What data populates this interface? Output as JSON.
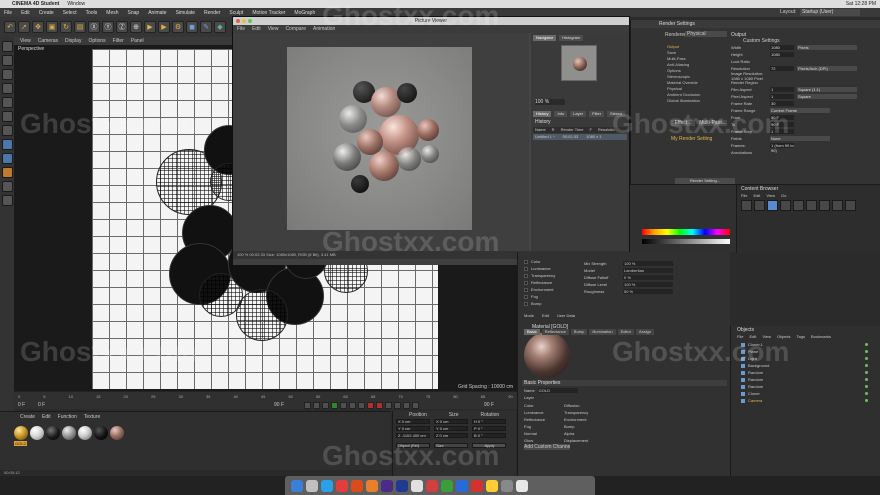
{
  "mac_menu": {
    "app": "CINEMA 4D Student",
    "window": "Window",
    "time": "Sat 12:28 PM"
  },
  "c4d_menu": [
    "File",
    "Edit",
    "Create",
    "Select",
    "Tools",
    "Mesh",
    "Snap",
    "Animate",
    "Simulate",
    "Render",
    "Sculpt",
    "Motion Tracker",
    "MoGraph"
  ],
  "layout_label": "Layout:",
  "layout_value": "Startup (User)",
  "viewport": {
    "menu": [
      "View",
      "Cameras",
      "Display",
      "Options",
      "Filter",
      "Panel"
    ],
    "name": "Perspective",
    "grid_spacing": "Grid Spacing : 10000 cm"
  },
  "timeline": {
    "ticks": [
      "0",
      "5",
      "10",
      "15",
      "20",
      "25",
      "30",
      "35",
      "40",
      "45",
      "50",
      "55",
      "60",
      "65",
      "70",
      "75",
      "80",
      "85",
      "90"
    ],
    "start": "0 F",
    "current": "0 F",
    "end": "90 F",
    "end2": "90 F"
  },
  "material_manager": {
    "menu": [
      "Create",
      "Edit",
      "Function",
      "Texture"
    ],
    "materials": [
      "GOLD",
      "",
      "",
      "",
      "",
      "",
      ""
    ]
  },
  "coordinates": {
    "headers": [
      "Position",
      "Size",
      "Rotation"
    ],
    "rows": [
      {
        "p": "X  0 cm",
        "s": "X  0 cm",
        "r": "H  0 °"
      },
      {
        "p": "Y  0 cm",
        "s": "Y  0 cm",
        "r": "P  0 °"
      },
      {
        "p": "Z  -1102.400 cm",
        "s": "Z  0 cm",
        "r": "B  0 °"
      }
    ],
    "mode": "Object (Rel)",
    "size_mode": "Size",
    "apply": "Apply"
  },
  "picture_viewer": {
    "title": "Picture Viewer",
    "menu": [
      "File",
      "Edit",
      "View",
      "Compare",
      "Animation"
    ],
    "tabs": [
      "Navigator",
      "Histogram"
    ],
    "zoom": "100 %",
    "sub_tabs": [
      "History",
      "Info",
      "Layer",
      "Filter",
      "Stereo"
    ],
    "history_label": "History",
    "cols": [
      "Name",
      "R",
      "Render Time",
      "F",
      "Resolutio"
    ],
    "history_row": {
      "name": "Untitled 1 *",
      "time": "00:02:33",
      "res": "1080 x 1"
    },
    "status": "100 %       00:02:33      Size: 1080x1080, RGB (8 Bit), 3.41 MB"
  },
  "render_settings": {
    "title": "Render Settings",
    "renderer_label": "Renderer",
    "renderer": "Physical",
    "list": [
      "Output",
      "Save",
      "Multi-Pass",
      "Anti-Aliasing",
      "Options",
      "Stereoscopic",
      "Material Override",
      "Physical",
      "Ambient Occlusion",
      "Global Illumination"
    ],
    "section": "Output",
    "preset": "Custom Settings",
    "fields": [
      {
        "k": "Width",
        "v": "1080",
        "d": "Pixels"
      },
      {
        "k": "Height",
        "v": "1080",
        "d": ""
      },
      {
        "k": "Lock Ratio",
        "v": "",
        "d": ""
      },
      {
        "k": "Resolution",
        "v": "72",
        "d": "Pixels/Inch (DPI)"
      },
      {
        "k": "Image Resolution: 1080 x 1080 Pixel",
        "v": "",
        "d": ""
      },
      {
        "k": "Render Region",
        "v": "",
        "d": ""
      },
      {
        "k": "Film Aspect",
        "v": "1",
        "d": "Square (1:1)"
      },
      {
        "k": "Pixel Aspect",
        "v": "1",
        "d": "Square"
      },
      {
        "k": "Frame Rate",
        "v": "30",
        "d": ""
      },
      {
        "k": "Frame Range",
        "v": "",
        "d": "Current Frame"
      },
      {
        "k": "From",
        "v": "90 F",
        "d": ""
      },
      {
        "k": "To",
        "v": "90 F",
        "d": ""
      },
      {
        "k": "Frame Step",
        "v": "1",
        "d": ""
      },
      {
        "k": "Fields",
        "v": "",
        "d": "None"
      },
      {
        "k": "Frames:",
        "v": "1 (from 90 to 90)",
        "d": ""
      },
      {
        "k": "Annotations",
        "v": "",
        "d": ""
      }
    ],
    "effect_btn": "Effect...",
    "multipass_btn": "Multi-Pass...",
    "my_setting": "My Render Setting",
    "render_setting_btn": "Render Setting..."
  },
  "content_browser": {
    "title": "Content Browser",
    "menu": [
      "File",
      "Edit",
      "View",
      "Go"
    ]
  },
  "material_editor": {
    "channels": [
      "Color",
      "Luminance",
      "Transparency",
      "Reflectance",
      "Environment",
      "Fog",
      "Bump"
    ],
    "props": [
      {
        "k": "Mix Strength",
        "v": "100 %"
      },
      {
        "k": "Model",
        "v": "Lambertian"
      },
      {
        "k": "Diffuse Falloff",
        "v": "0 %"
      },
      {
        "k": "Diffuse Level",
        "v": "100 %"
      },
      {
        "k": "Roughness",
        "v": "50 %"
      }
    ],
    "menu": [
      "Mode",
      "Edit",
      "User Data"
    ],
    "material_name": "Material [GOLD]",
    "tabs": [
      "Basic",
      "Reflectance",
      "Bump",
      "Illumination",
      "Editor",
      "Assign"
    ],
    "basic_title": "Basic Properties",
    "name_label": "Name",
    "name_value": "GOLD",
    "layer_label": "Layer",
    "left_channels": [
      "Color",
      "Luminance",
      "Reflectance",
      "Fog",
      "Normal",
      "Glow"
    ],
    "right_channels": [
      "Diffusion",
      "Transparency",
      "Environment",
      "Bump",
      "Alpha",
      "Displacement"
    ],
    "custom_btn": "Add Custom Channel"
  },
  "objects": {
    "title": "Objects",
    "menu": [
      "File",
      "Edit",
      "View",
      "Objects",
      "Tags",
      "Bookmarks"
    ],
    "rows": [
      "Cloner.1",
      "Plane",
      "Light",
      "Background",
      "Random",
      "Random",
      "Random",
      "Cloner",
      "Camera"
    ]
  },
  "watermark": "Ghostxx.com",
  "dock_colors": [
    "#3b7fd9",
    "#c0c0c0",
    "#2aa0e8",
    "#e23e3e",
    "#da4c1b",
    "#e87f2b",
    "#4b2a8a",
    "#1f3a8f",
    "#e0e0e0",
    "#d04040",
    "#3a9f3a",
    "#2a6ad8",
    "#d63030",
    "#ffcc33",
    "#888",
    "#e8e8e8"
  ],
  "status_left": "00:00:12"
}
